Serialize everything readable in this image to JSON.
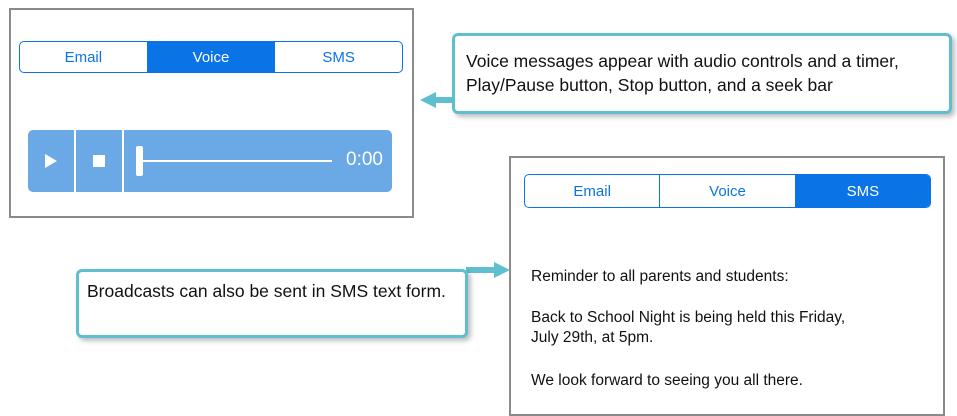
{
  "voice_panel": {
    "tabs": [
      {
        "label": "Email",
        "active": false
      },
      {
        "label": "Voice",
        "active": true
      },
      {
        "label": "SMS",
        "active": false
      }
    ],
    "player": {
      "play_icon": "play-icon",
      "stop_icon": "stop-icon",
      "seek_position": 0,
      "timer": "0:00"
    }
  },
  "sms_panel": {
    "tabs": [
      {
        "label": "Email",
        "active": false
      },
      {
        "label": "Voice",
        "active": false
      },
      {
        "label": "SMS",
        "active": true
      }
    ],
    "message_lines": [
      "Reminder to all parents and students:",
      "Back to School Night is being held this Friday, July 29th, at 5pm.",
      "We look forward to seeing you all there."
    ]
  },
  "callouts": {
    "voice": "Voice messages appear with audio controls and a timer, Play/Pause button, Stop button, and a seek bar",
    "sms": "Broadcasts can also be sent in SMS text form."
  },
  "colors": {
    "accent": "#0a74e6",
    "player_bg": "#6aa8e6",
    "callout_border": "#5fbfcf"
  }
}
